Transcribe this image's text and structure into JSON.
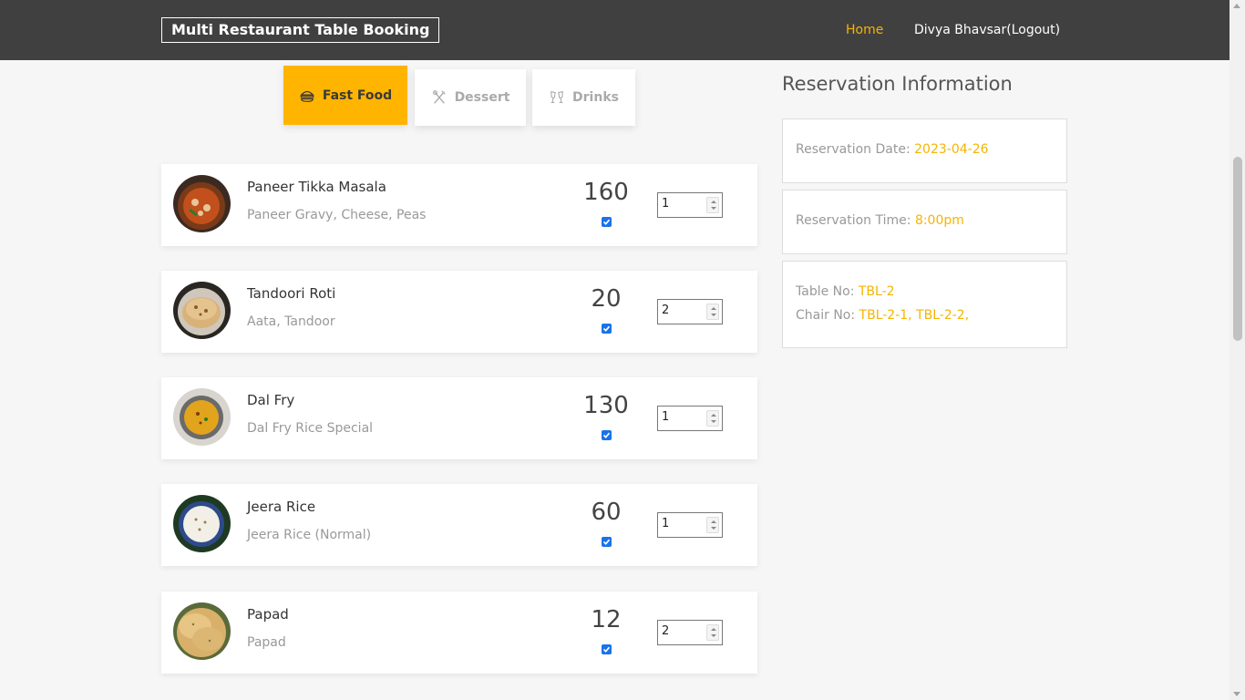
{
  "header": {
    "brand": "Multi Restaurant Table Booking",
    "nav": {
      "home": "Home",
      "user": "Divya Bhavsar(Logout)"
    }
  },
  "tabs": [
    {
      "label": "Fast Food",
      "icon": "burger-icon",
      "active": true
    },
    {
      "label": "Dessert",
      "icon": "utensils-icon",
      "active": false
    },
    {
      "label": "Drinks",
      "icon": "cheers-glasses-icon",
      "active": false
    }
  ],
  "menu_items": [
    {
      "name": "Paneer Tikka Masala",
      "desc": "Paneer Gravy, Cheese, Peas",
      "price": "160",
      "checked": true,
      "qty": "1",
      "image": "curry-bowl-image"
    },
    {
      "name": "Tandoori Roti",
      "desc": "Aata, Tandoor",
      "price": "20",
      "checked": true,
      "qty": "2",
      "image": "roti-plate-image"
    },
    {
      "name": "Dal Fry",
      "desc": "Dal Fry Rice Special",
      "price": "130",
      "checked": true,
      "qty": "1",
      "image": "dal-bowl-image"
    },
    {
      "name": "Jeera Rice",
      "desc": "Jeera Rice (Normal)",
      "price": "60",
      "checked": true,
      "qty": "1",
      "image": "rice-bowl-image"
    },
    {
      "name": "Papad",
      "desc": "Papad",
      "price": "12",
      "checked": true,
      "qty": "2",
      "image": "papad-plate-image"
    }
  ],
  "reservation": {
    "title": "Reservation Information",
    "date_label": "Reservation Date: ",
    "date": "2023-04-26",
    "time_label": "Reservation Time: ",
    "time": "8:00pm",
    "table_label": "Table No: ",
    "table": "TBL-2",
    "chair_label": "Chair No: ",
    "chairs": "TBL-2-1, TBL-2-2,"
  },
  "colors": {
    "accent": "#ffb400",
    "navbar": "#404040",
    "link_active": "#f5b400",
    "checkbox": "#1a73e8"
  }
}
